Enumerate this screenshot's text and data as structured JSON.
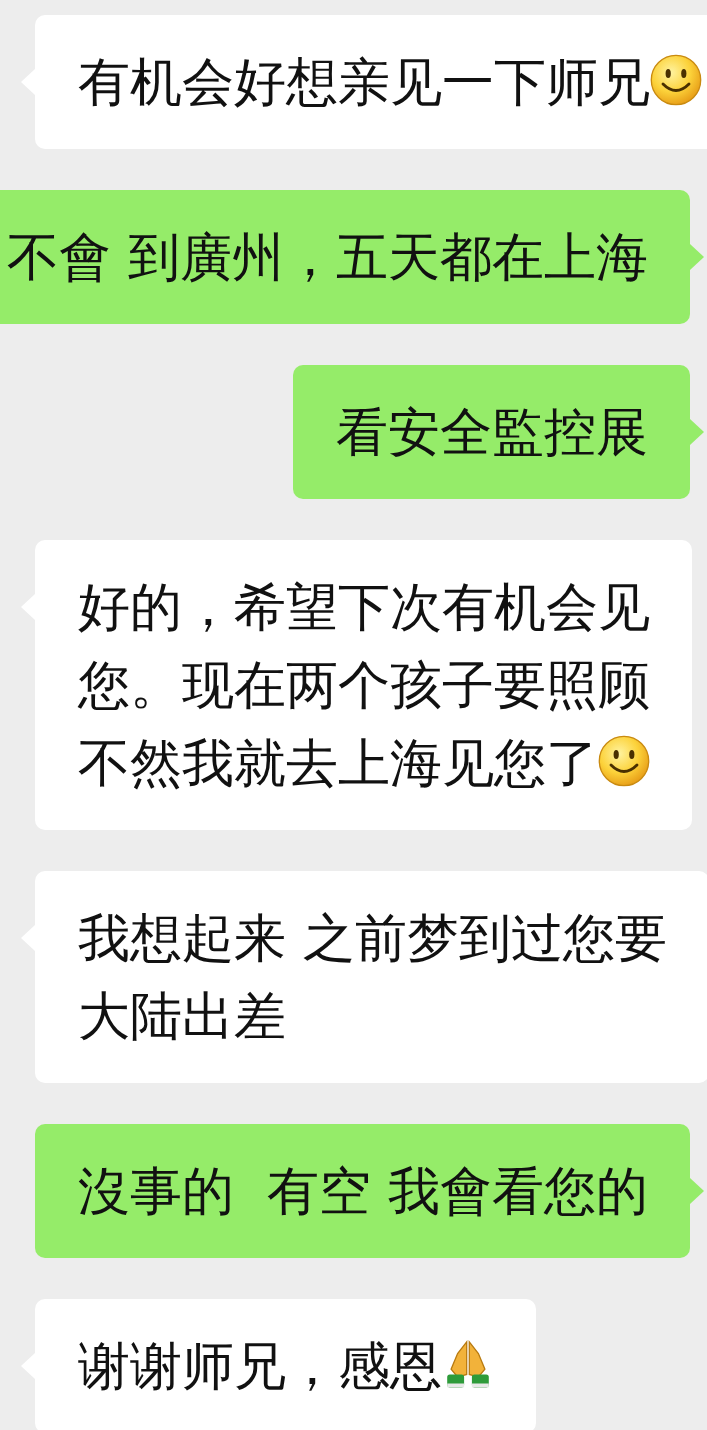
{
  "messages": [
    {
      "kind": "received",
      "lines": [
        "有机会好想亲见一下师兄"
      ]
    },
    {
      "kind": "sent",
      "lines": [
        "不會 到廣州，五天都在上海"
      ]
    },
    {
      "kind": "sent",
      "lines": [
        "看安全監控展"
      ]
    },
    {
      "kind": "received",
      "lines": [
        "好的，希望下次有机会见",
        "您。现在两个孩子要照顾",
        "不然我就去上海见您了"
      ]
    },
    {
      "kind": "received",
      "lines": [
        "我想起来 之前梦到过您要",
        "大陆出差"
      ]
    },
    {
      "kind": "sent",
      "lines": [
        "沒事的  有空 我會看您的"
      ]
    },
    {
      "kind": "received",
      "lines": [
        "谢谢师兄，感恩"
      ]
    }
  ]
}
